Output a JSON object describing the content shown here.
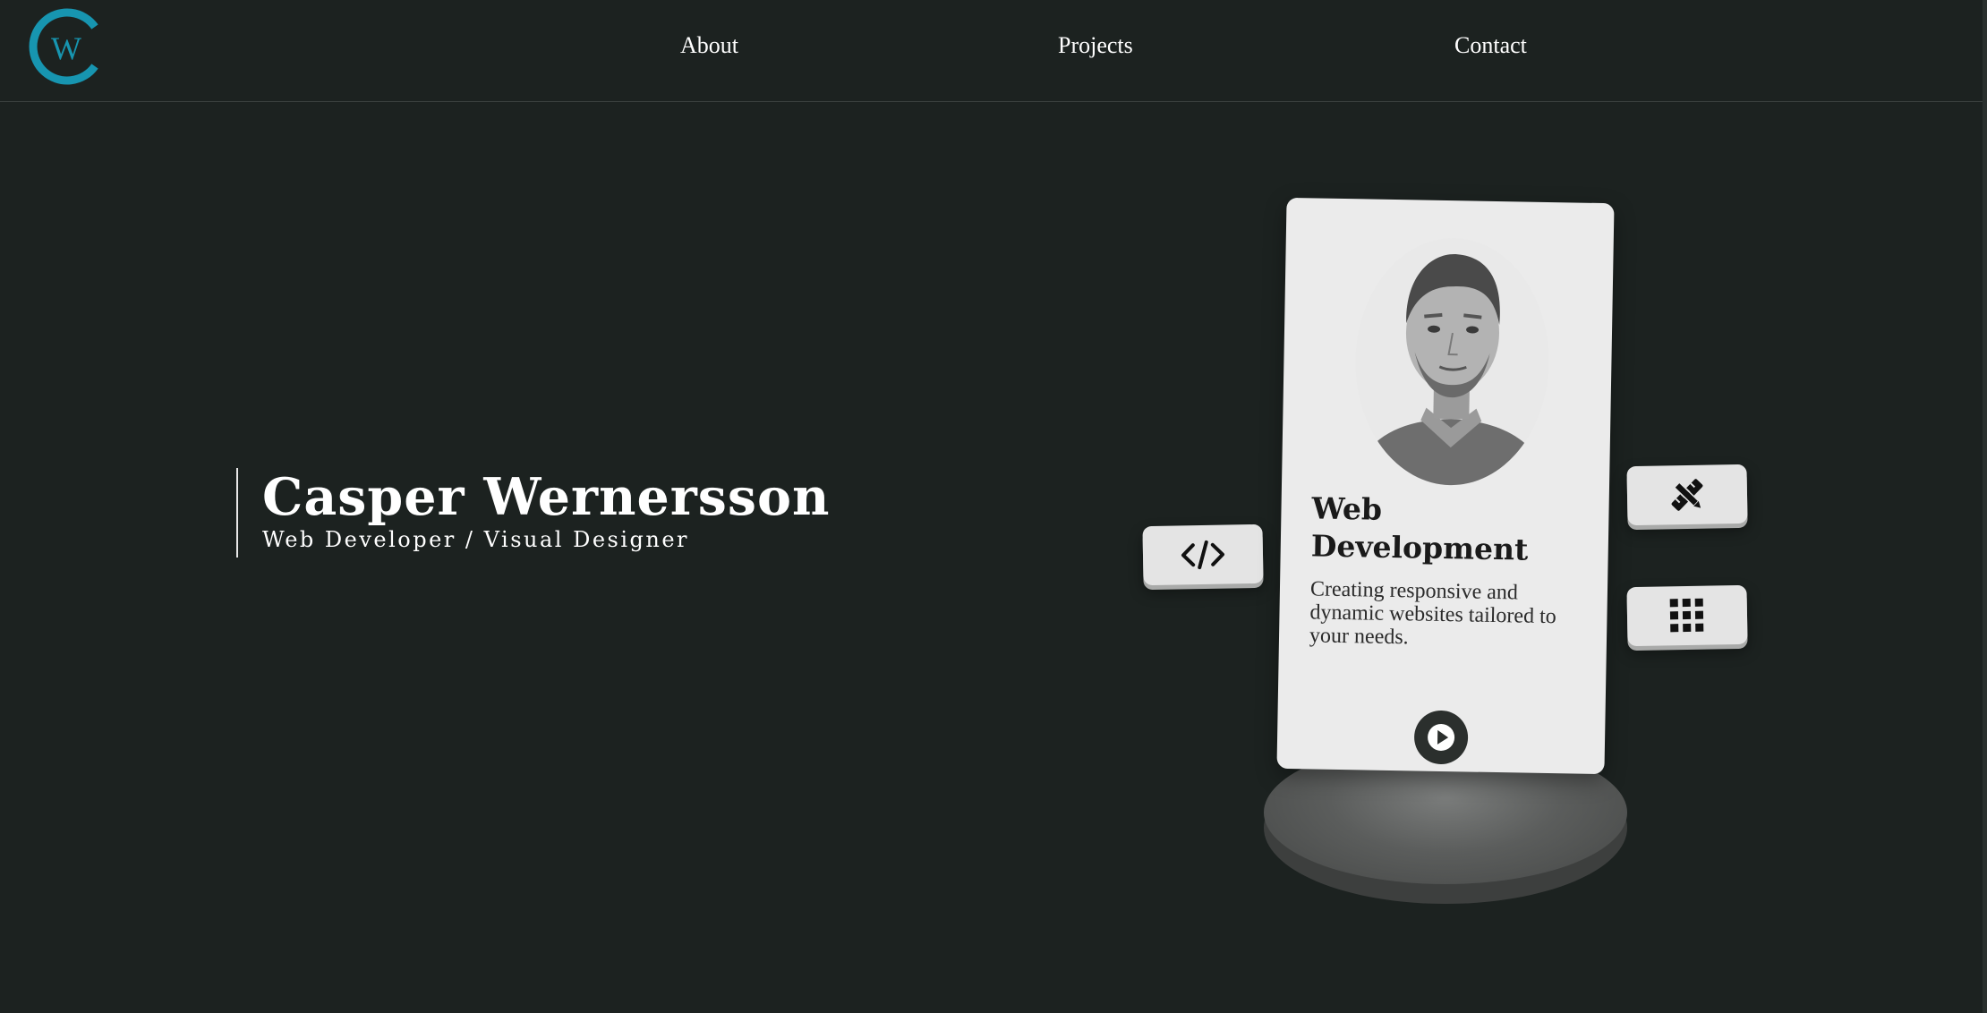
{
  "header": {
    "logo_letters": "CW",
    "logo_color": "#1795b0",
    "nav": [
      {
        "label": "About"
      },
      {
        "label": "Projects"
      },
      {
        "label": "Contact"
      }
    ]
  },
  "hero": {
    "name": "Casper Wernersson",
    "subtitle": "Web Developer / Visual Designer"
  },
  "card": {
    "title": "Web Development",
    "description": "Creating responsive and dynamic websites tailored to your needs.",
    "play_icon": "play-icon"
  },
  "side_buttons": [
    {
      "icon": "code-icon"
    },
    {
      "icon": "design-tools-icon"
    },
    {
      "icon": "grid-icon"
    }
  ],
  "colors": {
    "background": "#1c2220",
    "card": "#ebebeb",
    "accent": "#1795b0"
  }
}
